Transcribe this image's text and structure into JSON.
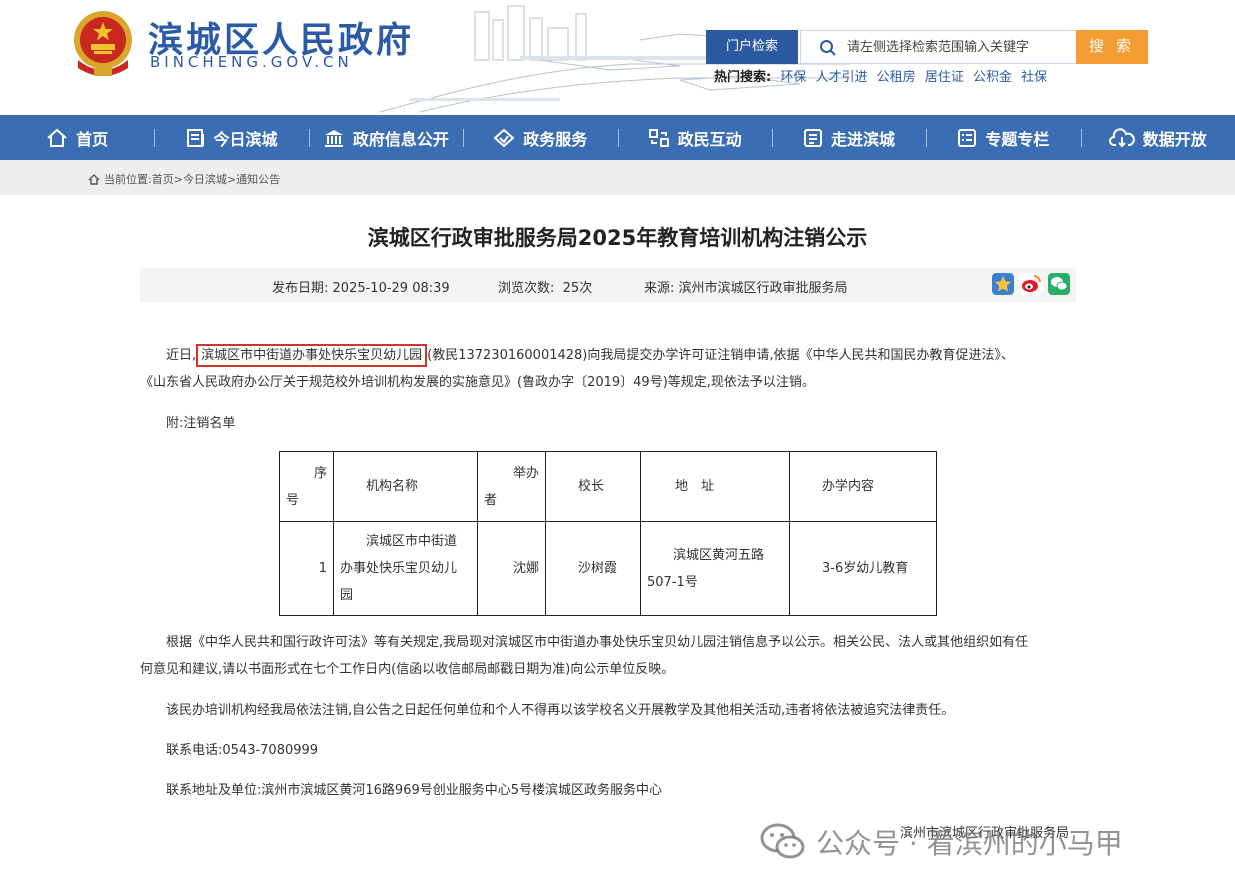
{
  "header": {
    "site_title": "滨城区人民政府",
    "site_domain": "BINCHENG.GOV.CN",
    "search_scope": "门户检索",
    "search_placeholder": "请左侧选择检索范围输入关键字",
    "search_button": "搜 索",
    "hot_label": "热门搜索:",
    "hot_links": [
      "环保",
      "人才引进",
      "公租房",
      "居住证",
      "公积金",
      "社保"
    ]
  },
  "nav": {
    "items": [
      {
        "label": "首页",
        "icon": "home-icon"
      },
      {
        "label": "今日滨城",
        "icon": "news-icon"
      },
      {
        "label": "政府信息公开",
        "icon": "building-icon"
      },
      {
        "label": "政务服务",
        "icon": "handshake-icon"
      },
      {
        "label": "政民互动",
        "icon": "interaction-icon"
      },
      {
        "label": "走进滨城",
        "icon": "book-icon"
      },
      {
        "label": "专题专栏",
        "icon": "list-icon"
      },
      {
        "label": "数据开放",
        "icon": "cloud-download-icon"
      }
    ]
  },
  "breadcrumb": {
    "label": "当前位置:",
    "items": [
      "首页",
      "今日滨城",
      "通知公告"
    ],
    "sep": ">"
  },
  "article": {
    "title": "滨城区行政审批服务局2025年教育培训机构注销公示",
    "date_label": "发布日期:",
    "date": "2025-10-29 08:39",
    "views_label": "浏览次数:",
    "views": "25次",
    "source_label": "来源:",
    "source": "滨州市滨城区行政审批服务局",
    "p1_lead": "近日,",
    "p1_highlight": "滨城区市中街道办事处快乐宝贝幼儿园",
    "p1_rest": "(教民137230160001428)向我局提交办学许可证注销申请,依据《中华人民共和国民办教育促进法》、",
    "p1_line2": "《山东省人民政府办公厅关于规范校外培训机构发展的实施意见》(鲁政办字〔2019〕49号)等规定,现依法予以注销。",
    "attach": "附:注销名单",
    "p2_line1": "根据《中华人民共和国行政许可法》等有关规定,我局现对滨城区市中街道办事处快乐宝贝幼儿园注销信息予以公示。相关公民、法人或其他组织如有任",
    "p2_line2": "何意见和建议,请以书面形式在七个工作日内(信函以收信邮局邮戳日期为准)向公示单位反映。",
    "p3": "该民办培训机构经我局依法注销,自公告之日起任何单位和个人不得再以该学校名义开展教学及其他相关活动,违者将依法被追究法律责任。",
    "phone": "联系电话:0543-7080999",
    "address": "联系地址及单位:滨州市滨城区黄河16路969号创业服务中心5号楼滨城区政务服务中心",
    "signature": "滨州市滨城区行政审批服务局"
  },
  "table": {
    "headers": [
      [
        "序",
        "号"
      ],
      [
        "机构名称"
      ],
      [
        "举办",
        "者"
      ],
      [
        "校长"
      ],
      [
        "地　址"
      ],
      [
        "办学内容"
      ]
    ],
    "rows": [
      {
        "no": "1",
        "name": [
          "滨城区市中街道",
          "办事处快乐宝贝幼儿",
          "园"
        ],
        "founder": "沈娜",
        "principal": "沙树霞",
        "address": [
          "滨城区黄河五路",
          "507-1号"
        ],
        "content": "3-6岁幼儿教育"
      }
    ]
  },
  "watermark": {
    "text": "公众号 · 看滨州的小马甲"
  },
  "colors": {
    "nav_blue": "#3a6db2",
    "title_blue": "#2b5aa6",
    "search_orange": "#f39c32",
    "highlight_red": "#d0342c"
  }
}
